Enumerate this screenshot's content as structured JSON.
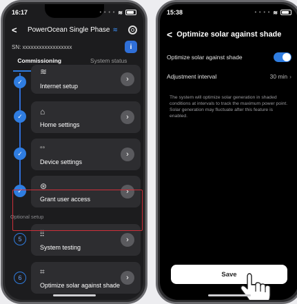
{
  "left_phone": {
    "status_time": "16:17",
    "header": {
      "title": "PowerOcean Single Phase"
    },
    "sn_label": "SN: xxxxxxxxxxxxxxxxxx",
    "info_label": "i",
    "tabs": [
      {
        "label": "Commissioning",
        "active": true
      },
      {
        "label": "System status",
        "active": false
      }
    ],
    "steps": [
      {
        "label": "Internet setup",
        "icon": "wifi-icon",
        "status": "done"
      },
      {
        "label": "Home settings",
        "icon": "home-icon",
        "status": "done"
      },
      {
        "label": "Device settings",
        "icon": "grid-icon",
        "status": "done"
      },
      {
        "label": "Grant user access",
        "icon": "user-icon",
        "status": "done"
      }
    ],
    "optional_label": "Optional setup",
    "optional_steps": [
      {
        "number": "5",
        "label": "System testing",
        "icon": "sliders-icon"
      },
      {
        "number": "6",
        "label": "Optimize solar against shade",
        "icon": "solar-panel-icon"
      }
    ]
  },
  "right_phone": {
    "status_time": "15:38",
    "title": "Optimize solar against shade",
    "toggle_row": {
      "label": "Optimize solar against shade",
      "enabled": true
    },
    "interval_row": {
      "label": "Adjustment interval",
      "value": "30 min"
    },
    "description": "The system will optimize solar generation in shaded conditions at intervals to track the maximum power point. Solar generation may fluctuate after this feature is enabled.",
    "save_label": "Save"
  },
  "colors": {
    "accent": "#2f7de1",
    "highlight": "#d0303a"
  }
}
